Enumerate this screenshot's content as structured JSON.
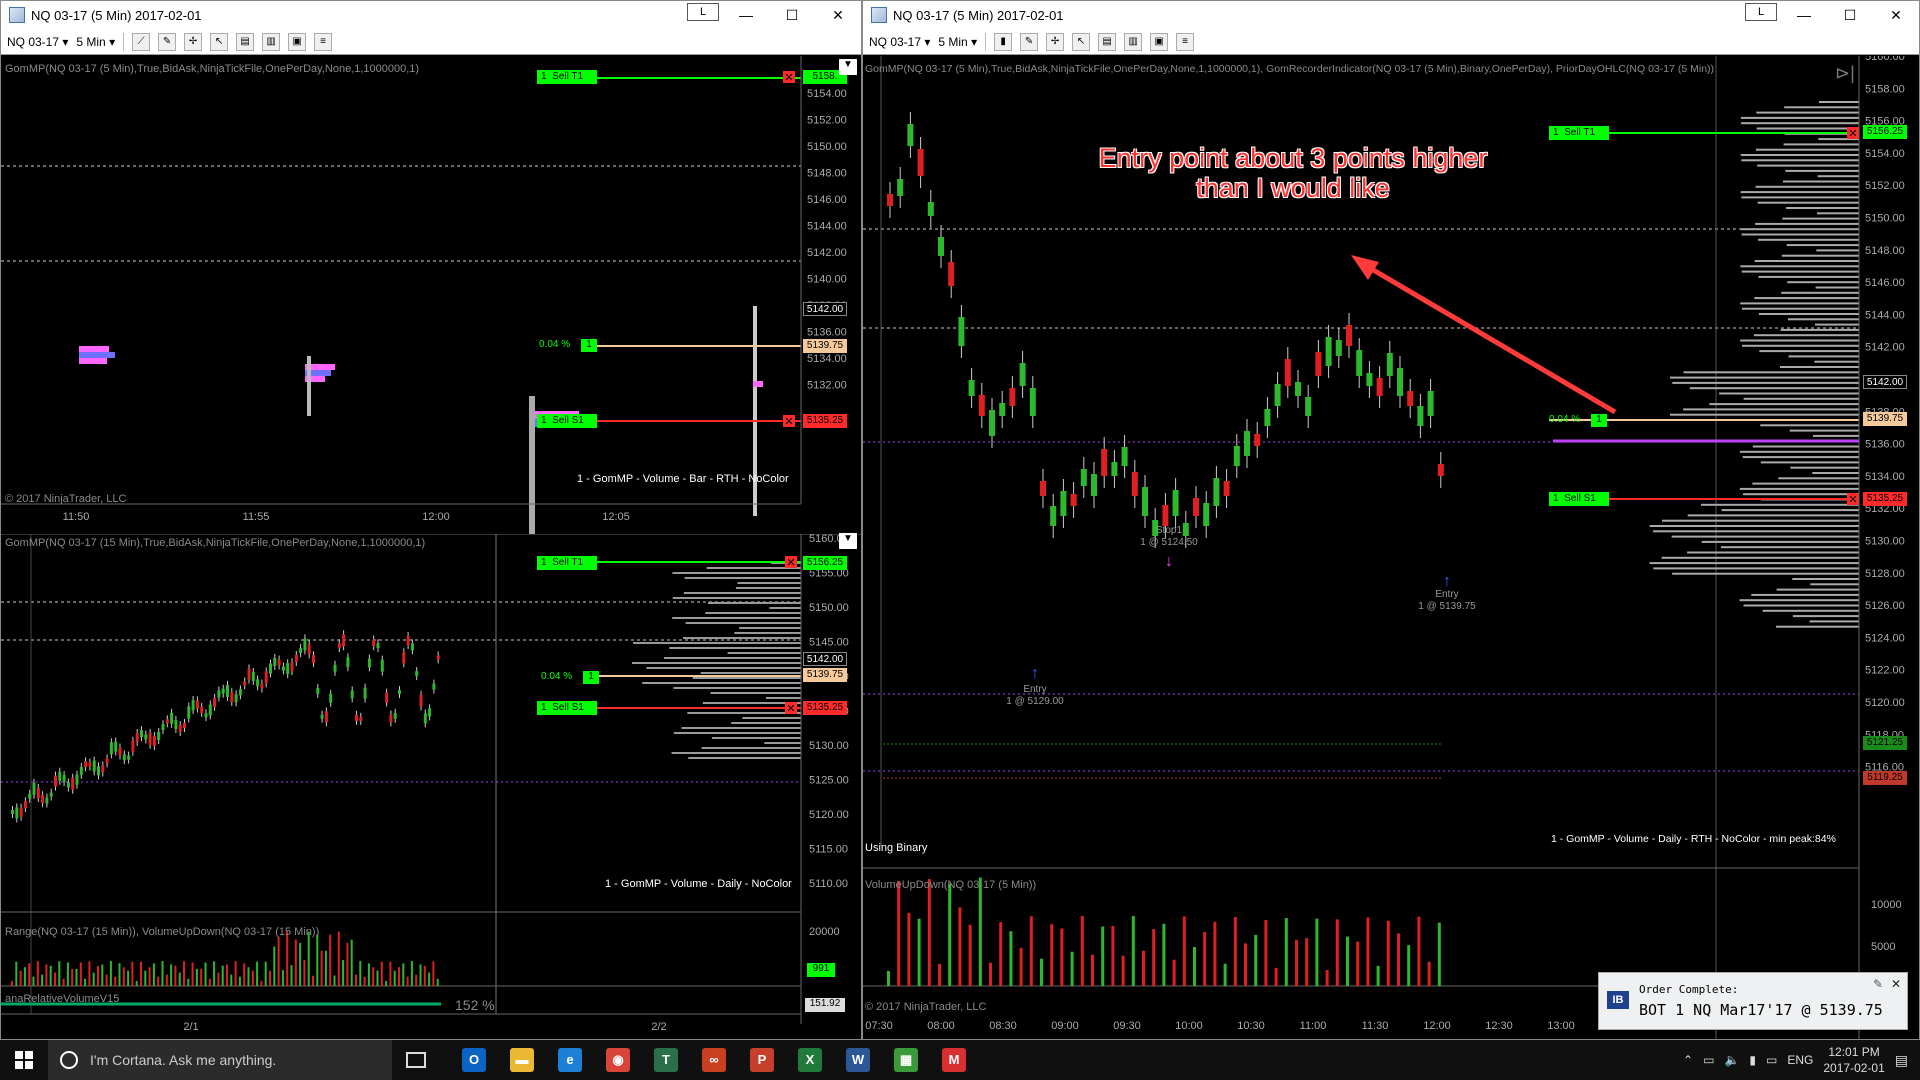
{
  "windows": {
    "left": {
      "title": "NQ 03-17 (5 Min)  2017-02-01",
      "link_label": "L",
      "instrument": "NQ 03-17",
      "interval": "5 Min",
      "panel_top": {
        "indicator_label": "GomMP(NQ 03-17 (5 Min),True,BidAsk,NinjaTickFile,OnePerDay,None,1,1000000,1)",
        "copyright": "© 2017 NinjaTrader, LLC",
        "footer_label": "1 - GomMP - Volume - Bar - RTH - NoColor",
        "price_ticks": [
          "5154.00",
          "5152.00",
          "5150.00",
          "5148.00",
          "5146.00",
          "5144.00",
          "5142.00",
          "5140.00",
          "5138.00",
          "5136.00",
          "5134.00",
          "5132.00"
        ],
        "price_boxes": [
          {
            "text": "5158.",
            "color": "#00ff00"
          },
          {
            "text": "5142.00",
            "color": "#000000"
          },
          {
            "text": "5139.75",
            "color": "#f5c99a"
          },
          {
            "text": "5135.25",
            "color": "#ff2a2a"
          }
        ],
        "orders": [
          {
            "qty": "1",
            "label": "Sell T1"
          },
          {
            "qty": "1",
            "label": "Sell S1"
          }
        ],
        "pct_label": "0.04 %",
        "pct_qty": "1",
        "time_ticks": [
          "11:50",
          "11:55",
          "12:00",
          "12:05"
        ]
      },
      "panel_bottom": {
        "indicator_label": "GomMP(NQ 03-17 (15 Min),True,BidAsk,NinjaTickFile,OnePerDay,None,1,1000000,1)",
        "footer_label": "1 - GomMP - Volume - Daily - NoColor",
        "price_ticks": [
          "5160.00",
          "5155.00",
          "5150.00",
          "5145.00",
          "5140.00",
          "5135.00",
          "5130.00",
          "5125.00",
          "5120.00",
          "5115.00",
          "5110.00"
        ],
        "price_boxes": [
          {
            "text": "5156.25",
            "color": "#00ff00"
          },
          {
            "text": "5142.00",
            "color": "#000000"
          },
          {
            "text": "5139.75",
            "color": "#f5c99a"
          },
          {
            "text": "5135.25",
            "color": "#ff2a2a"
          }
        ],
        "orders": [
          {
            "qty": "1",
            "label": "Sell T1"
          },
          {
            "qty": "1",
            "label": "Sell S1"
          }
        ],
        "pct_label": "0.04 %",
        "pct_qty": "1",
        "range_label": "Range(NQ 03-17 (15 Min)), VolumeUpDown(NQ 03-17 (15 Min))",
        "range_tick": "20000",
        "range_box": "991",
        "rel_label": "anaRelativeVolumeV15",
        "rel_pct": "152 %",
        "rel_box": "151.92",
        "time_ticks": [
          "2/1",
          "2/2"
        ]
      }
    },
    "right": {
      "title": "NQ 03-17 (5 Min)  2017-02-01",
      "link_label": "L",
      "instrument": "NQ 03-17",
      "interval": "5 Min",
      "indicator_label": "GomMP(NQ 03-17 (5 Min),True,BidAsk,NinjaTickFile,OnePerDay,None,1,1000000,1), GomRecorderIndicator(NQ 03-17 (5 Min),Binary,OnePerDay), PriorDayOHLC(NQ 03-17 (5 Min))",
      "annotation_line1": "Entry point about 3 points higher",
      "annotation_line2": "than I would like",
      "price_ticks": [
        "5160.00",
        "5158.00",
        "5156.00",
        "5154.00",
        "5152.00",
        "5150.00",
        "5148.00",
        "5146.00",
        "5144.00",
        "5142.00",
        "5140.00",
        "5138.00",
        "5136.00",
        "5134.00",
        "5132.00",
        "5130.00",
        "5128.00",
        "5126.00",
        "5124.00",
        "5122.00",
        "5120.00",
        "5118.00",
        "5116.00"
      ],
      "price_boxes": [
        {
          "text": "5156.25",
          "color": "#00ff00"
        },
        {
          "text": "5142.00",
          "color": "#000000"
        },
        {
          "text": "5139.75",
          "color": "#f5c99a"
        },
        {
          "text": "5135.25",
          "color": "#ff2a2a"
        },
        {
          "text": "5121.25",
          "color": "#1a8a1a"
        },
        {
          "text": "5119.25",
          "color": "#c0392b"
        }
      ],
      "orders": [
        {
          "qty": "1",
          "label": "Sell T1"
        },
        {
          "qty": "1",
          "label": "Sell S1"
        }
      ],
      "pct_label": "0.04 %",
      "pct_qty": "1",
      "entry1_label": "Entry",
      "entry1_detail": "1 @ 5129.00",
      "stop_label": "Stop1",
      "stop_detail": "1 @ 5124.50",
      "entry2_label": "Entry",
      "entry2_detail": "1 @ 5139.75",
      "binary_label": "Using Binary",
      "footer_label": "1 - GomMP - Volume - Daily - RTH - NoColor - min peak:84%",
      "volume_label": "VolumeUpDown(NQ 03-17 (5 Min))",
      "volume_ticks": [
        "10000",
        "5000"
      ],
      "copyright": "© 2017 NinjaTrader, LLC",
      "time_ticks": [
        "07:30",
        "08:00",
        "08:30",
        "09:00",
        "09:30",
        "10:00",
        "10:30",
        "11:00",
        "11:30",
        "12:00",
        "12:30",
        "13:00"
      ]
    }
  },
  "notification": {
    "badge": "IB",
    "title": "Order Complete:",
    "message": "BOT 1 NQ Mar17'17 @ 5139.75"
  },
  "taskbar": {
    "search_placeholder": "I'm Cortana. Ask me anything.",
    "language": "ENG",
    "time": "12:01 PM",
    "date": "2017-02-01",
    "apps": [
      {
        "name": "outlook",
        "glyph": "O",
        "color": "#0a64c4"
      },
      {
        "name": "file-explorer",
        "glyph": "▬",
        "color": "#e8b931"
      },
      {
        "name": "edge",
        "glyph": "e",
        "color": "#1e7fd6"
      },
      {
        "name": "chrome",
        "glyph": "◉",
        "color": "#d9443a"
      },
      {
        "name": "tws",
        "glyph": "T",
        "color": "#2a6e4a"
      },
      {
        "name": "ninjatrader",
        "glyph": "∞",
        "color": "#c9401f"
      },
      {
        "name": "powerpoint",
        "glyph": "P",
        "color": "#c4402a"
      },
      {
        "name": "excel",
        "glyph": "X",
        "color": "#1f7a3c"
      },
      {
        "name": "word",
        "glyph": "W",
        "color": "#2b5797"
      },
      {
        "name": "calculator",
        "glyph": "▦",
        "color": "#3a9a3a"
      },
      {
        "name": "other-app",
        "glyph": "M",
        "color": "#d83030"
      }
    ]
  }
}
